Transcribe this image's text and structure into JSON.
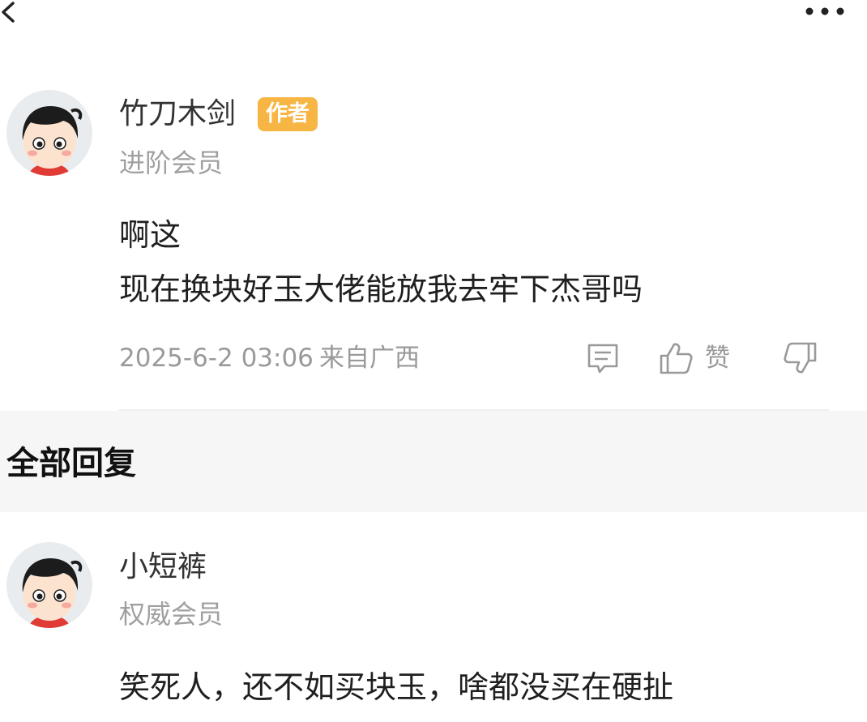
{
  "topbar": {
    "back_icon": "chevron-left-icon",
    "more_icon": "more-dots-icon"
  },
  "main_comment": {
    "user_name": "竹刀木剑",
    "badge": "作者",
    "member_level": "进阶会员",
    "lines": [
      "啊这",
      "现在换块好玉大佬能放我去牢下杰哥吗"
    ],
    "date": "2025-6-2 03:06",
    "location": "来自广西",
    "like_label": "赞",
    "icons": {
      "reply": "comment-icon",
      "like": "thumbs-up-icon",
      "dislike": "thumbs-down-icon"
    },
    "badge_color": "#f7b544"
  },
  "replies_section": {
    "title": "全部回复"
  },
  "reply": {
    "user_name": "小短裤",
    "member_level": "权威会员",
    "text": "笑死人，还不如买块玉，啥都没买在硬扯"
  }
}
